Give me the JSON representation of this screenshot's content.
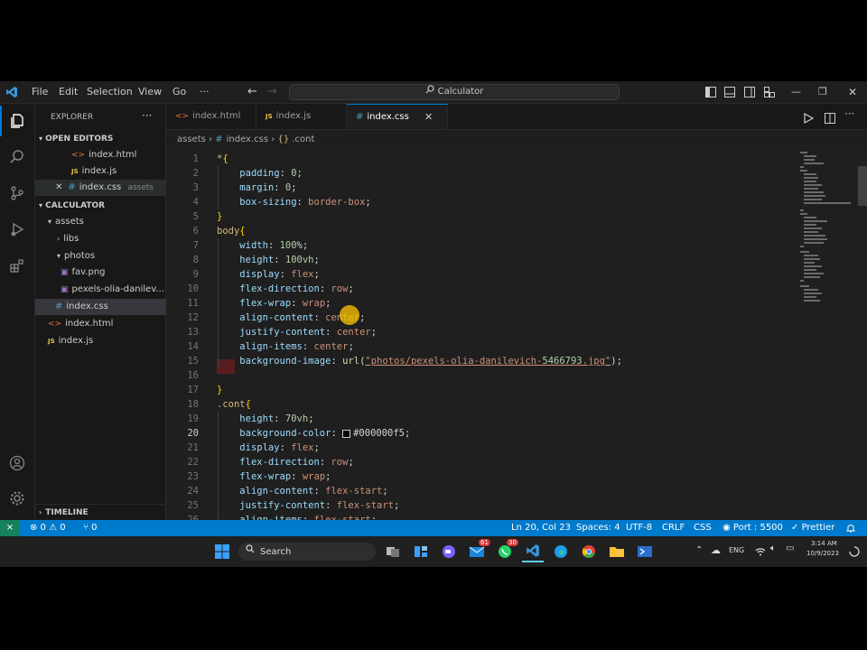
{
  "titlebar": {
    "menu": [
      "File",
      "Edit",
      "Selection",
      "View",
      "Go",
      "···"
    ],
    "search": "Calculator"
  },
  "explorer": {
    "title": "EXPLORER",
    "more": "···",
    "open_editors_label": "OPEN EDITORS",
    "open_editors": [
      {
        "name": "index.html",
        "kind": "html"
      },
      {
        "name": "index.js",
        "kind": "js"
      },
      {
        "name": "index.css",
        "kind": "css",
        "detail": "assets"
      }
    ],
    "project_label": "CALCULATOR",
    "tree": [
      {
        "name": "assets",
        "kind": "folder-open",
        "depth": 1
      },
      {
        "name": "libs",
        "kind": "folder",
        "depth": 2
      },
      {
        "name": "photos",
        "kind": "folder-open",
        "depth": 2
      },
      {
        "name": "fav.png",
        "kind": "image",
        "depth": 3
      },
      {
        "name": "pexels-olia-danilev...",
        "kind": "image",
        "depth": 3
      },
      {
        "name": "index.css",
        "kind": "css",
        "depth": 2
      },
      {
        "name": "index.html",
        "kind": "html",
        "depth": 1
      },
      {
        "name": "index.js",
        "kind": "js",
        "depth": 1
      }
    ],
    "timeline_label": "TIMELINE"
  },
  "tabs": [
    {
      "label": "index.html",
      "kind": "html"
    },
    {
      "label": "index.js",
      "kind": "js"
    },
    {
      "label": "index.css",
      "kind": "css"
    }
  ],
  "breadcrumb": {
    "folder": "assets",
    "file": "index.css",
    "symbol": ".cont"
  },
  "editor": {
    "current_line": 20,
    "lines": [
      {
        "n": "1",
        "t": "*{"
      },
      {
        "n": "2",
        "t": "    padding: 0;"
      },
      {
        "n": "3",
        "t": "    margin: 0;"
      },
      {
        "n": "4",
        "t": "    box-sizing: border-box;"
      },
      {
        "n": "5",
        "t": "}"
      },
      {
        "n": "6",
        "t": "body{"
      },
      {
        "n": "7",
        "t": "    width: 100%;"
      },
      {
        "n": "8",
        "t": "    height: 100vh;"
      },
      {
        "n": "9",
        "t": "    display: flex;"
      },
      {
        "n": "10",
        "t": "    flex-direction: row;"
      },
      {
        "n": "11",
        "t": "    flex-wrap: wrap;"
      },
      {
        "n": "12",
        "t": "    align-content: center;"
      },
      {
        "n": "13",
        "t": "    justify-content: center;"
      },
      {
        "n": "14",
        "t": "    align-items: center;"
      },
      {
        "n": "15",
        "t": "    background-image: url(\"photos/pexels-olia-danilevich-5466793.jpg\");"
      },
      {
        "n": "16",
        "t": ""
      },
      {
        "n": "17",
        "t": "}"
      },
      {
        "n": "18",
        "t": ".cont{"
      },
      {
        "n": "19",
        "t": "    height: 70vh;"
      },
      {
        "n": "20",
        "t": "    background-color: ■#000000f5;"
      },
      {
        "n": "21",
        "t": "    display: flex;"
      },
      {
        "n": "22",
        "t": "    flex-direction: row;"
      },
      {
        "n": "23",
        "t": "    flex-wrap: wrap;"
      },
      {
        "n": "24",
        "t": "    align-content: flex-start;"
      },
      {
        "n": "25",
        "t": "    justify-content: flex-start;"
      },
      {
        "n": "26",
        "t": "    align-items: flex-start;"
      }
    ]
  },
  "statusbar": {
    "remote": "⨯",
    "problems": "⊗ 0 ⚠ 0",
    "ports": "⑂ 0",
    "position": "Ln 20, Col 23",
    "spaces": "Spaces: 4",
    "encoding": "UTF-8",
    "eol": "CRLF",
    "language": "CSS",
    "server": "Port : 5500",
    "formatter": "Prettier"
  },
  "taskbar": {
    "search": "Search",
    "lang": "ENG",
    "time": "3:14 AM",
    "date": "10/9/2023",
    "badge_mail": "61",
    "badge_whatsapp": "30"
  },
  "colors": {
    "accent": "#007acc",
    "editor_bg": "#1f1f1f",
    "sidebar_bg": "#181818"
  }
}
